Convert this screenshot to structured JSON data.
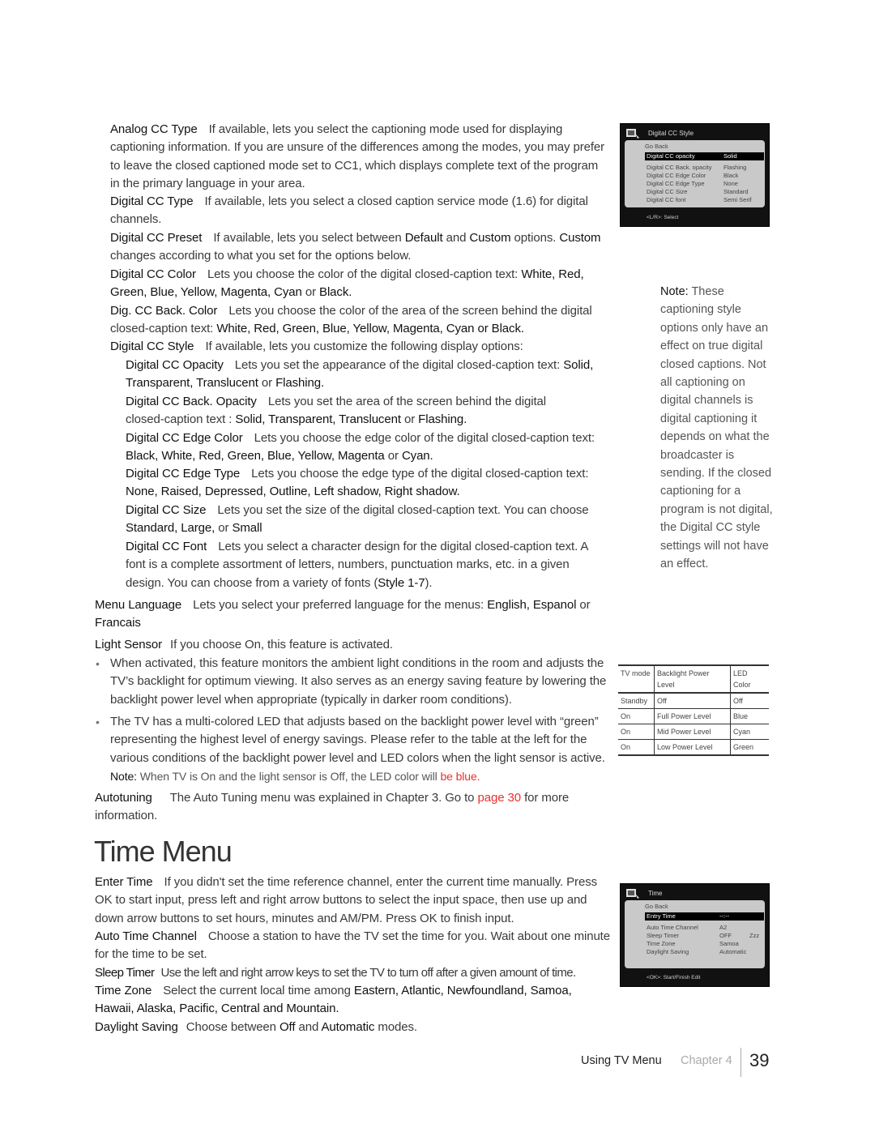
{
  "sections": {
    "analog_cc_type": {
      "term": "Analog CC Type",
      "text": "If available, lets you select the captioning mode used for displaying captioning information. If you are unsure of the differences among the modes, you may prefer to leave the closed captioned mode set to CC1, which displays complete text of the program in the primary language in your area."
    },
    "digital_cc_type": {
      "term": "Digital CC Type",
      "text": "If available, lets you select a closed caption service mode (1.6) for digital channels."
    },
    "digital_cc_preset": {
      "term": "Digital CC Preset",
      "text1": "If available, lets you select between ",
      "opt1": "Default",
      "text2": " and ",
      "opt2": "Custom",
      "text3": " options. ",
      "opt3": "Custom",
      "text4": " changes according to what you set for the options below."
    },
    "digital_cc_color": {
      "term": "Digital CC Color",
      "text": "Lets you choose the color of the digital closed-caption text: ",
      "options": "White, Red, Green, Blue, Yellow, Magenta, Cyan",
      "or": " or ",
      "last": "Black."
    },
    "dig_cc_back_color": {
      "term": "Dig. CC Back. Color",
      "text": "Lets you choose the color of the area of the screen behind the digital closed-caption text: ",
      "options": "White, Red, Green, Blue, Yellow, Magenta, Cyan or Black."
    },
    "digital_cc_style": {
      "term": "Digital CC Style",
      "text": "If available, lets you customize the following display options:"
    },
    "digital_cc_opacity": {
      "term": "Digital CC Opacity",
      "text": "Lets you set the appearance of the digital closed-caption text: ",
      "options": "Solid,  Transparent, Translucent",
      "or": " or ",
      "last": "Flashing."
    },
    "digital_cc_back_opacity": {
      "term": "Digital CC Back. Opacity",
      "text": "Lets you set the area of the screen behind the digital closed-caption text : ",
      "options": "Solid, Transparent, Translucent",
      "or": " or ",
      "last": "Flashing."
    },
    "digital_cc_edge_color": {
      "term": "Digital CC Edge Color",
      "text": "Lets you choose the edge color of the  digital closed-caption text: ",
      "options": "Black, White, Red, Green, Blue, Yellow, Magenta",
      "or": " or ",
      "last": "Cyan."
    },
    "digital_cc_edge_type": {
      "term": "Digital CC Edge Type",
      "text": "Lets you choose the edge type of the  digital closed-caption text: ",
      "options": "None, Raised, Depressed, Outline, Left shadow, Right shadow."
    },
    "digital_cc_size": {
      "term": "Digital CC Size",
      "text": "Lets you set the size of the digital closed-caption text. You can choose ",
      "options": "Standard, Large,",
      "or": " or ",
      "last": "Small"
    },
    "digital_cc_font": {
      "term": "Digital CC Font",
      "text": "Lets you select a character design for the digital closed-caption text. A font is a complete assortment of letters, numbers, punctuation marks, etc. in a given design. You can choose from a variety of fonts (",
      "options": "Style 1-7",
      "end": ")."
    },
    "menu_language": {
      "term": "Menu Language",
      "text": "Lets you select your preferred language for the menus: ",
      "options": "English, Espanol",
      "or": " or ",
      "last": "Francais"
    },
    "light_sensor": {
      "term": "Light Sensor",
      "text": "If you choose On, this feature is activated.",
      "bullets": [
        "When activated, this feature monitors the ambient light conditions in the room and adjusts the TV’s backlight for optimum viewing. It also serves as an energy saving feature by lowering the backlight power level when appropriate (typically in darker room conditions).",
        "The TV has a multi-colored LED that adjusts based on the backlight power level with “green” representing the highest level of energy savings. Please refer to the table at the left for the various conditions of the backlight power level and LED colors when the light sensor is active."
      ],
      "note_label": "Note:",
      "note_text": "When TV is On and the light sensor is Off, the LED color will",
      "note_red": "be blue."
    },
    "autotuning": {
      "term": "Autotuning",
      "text1": "The Auto Tuning menu was explained in Chapter 3. Go to ",
      "link": "page 30",
      "text2": " for more information."
    }
  },
  "time_menu": {
    "heading": "Time Menu",
    "enter_time": {
      "term": "Enter Time",
      "text": "If you didn't set the time reference channel, enter the current time manually. Press OK to start input, press left and right arrow buttons to select the input space, then use up and down arrow buttons to set hours, minutes and AM/PM. Press OK to finish input."
    },
    "auto_time_channel": {
      "term": "Auto Time Channel",
      "text": "Choose a station to have the TV set the time for you. Wait about one minute for the time to be set."
    },
    "sleep_timer": {
      "term": "Sleep Timer",
      "text": "Use the left and right arrow keys to set the TV to turn off after a given amount of time."
    },
    "time_zone": {
      "term": "Time Zone",
      "text": "Select the current local time among ",
      "options": "Eastern, Atlantic, Newfoundland, Samoa, Hawaii, Alaska, Pacific, Central and Mountain."
    },
    "daylight_saving": {
      "term": "Daylight Saving",
      "text1": "Choose between ",
      "opt1": "Off",
      "text2": " and ",
      "opt2": "Automatic",
      "text3": " modes."
    }
  },
  "side_note": {
    "label": "Note:",
    "text": "These captioning style options only have an effect on true digital closed captions. Not all captioning on digital channels is digital captioning it depends on what the broadcaster is sending. If the closed captioning for a program is not digital, the Digital CC style settings will not have an effect."
  },
  "osd_cc_style": {
    "title": "Digital CC Style",
    "go_back": "Go Back",
    "rows": [
      {
        "label": "Digital CC opacity",
        "value": "Solid",
        "selected": true
      },
      {
        "label": "Digital CC Back. opacity",
        "value": "Flashing"
      },
      {
        "label": "Digital CC Edge Color",
        "value": "Black"
      },
      {
        "label": "Digital CC Edge Type",
        "value": "None"
      },
      {
        "label": "Digital CC Size",
        "value": "Standard"
      },
      {
        "label": "Digital CC font",
        "value": "Semi Serif"
      }
    ],
    "footer": "<L/R>: Select"
  },
  "osd_time": {
    "title": "Time",
    "go_back": "Go Back",
    "rows": [
      {
        "label": "Entry Time",
        "value": "--:--",
        "selected": true
      },
      {
        "label": "Auto Time Channel",
        "value": "A2"
      },
      {
        "label": "Sleep Timer",
        "value": "OFF",
        "extra": "Zzz"
      },
      {
        "label": "Time Zone",
        "value": "Samoa"
      },
      {
        "label": "Daylight Saving",
        "value": "Automatic"
      }
    ],
    "footer": "<OK>: Start/Finish Edit"
  },
  "led_table": {
    "headers": [
      "TV mode",
      "Backlight Power Level",
      "LED Color"
    ],
    "rows": [
      [
        "Standby",
        "Off",
        "Off"
      ],
      [
        "On",
        "Full Power Level",
        "Blue"
      ],
      [
        "On",
        "Mid Power Level",
        "Cyan"
      ],
      [
        "On",
        "Low Power Level",
        "Green"
      ]
    ]
  },
  "footer": {
    "section": "Using TV Menu",
    "chapter": "Chapter 4",
    "page": "39"
  }
}
